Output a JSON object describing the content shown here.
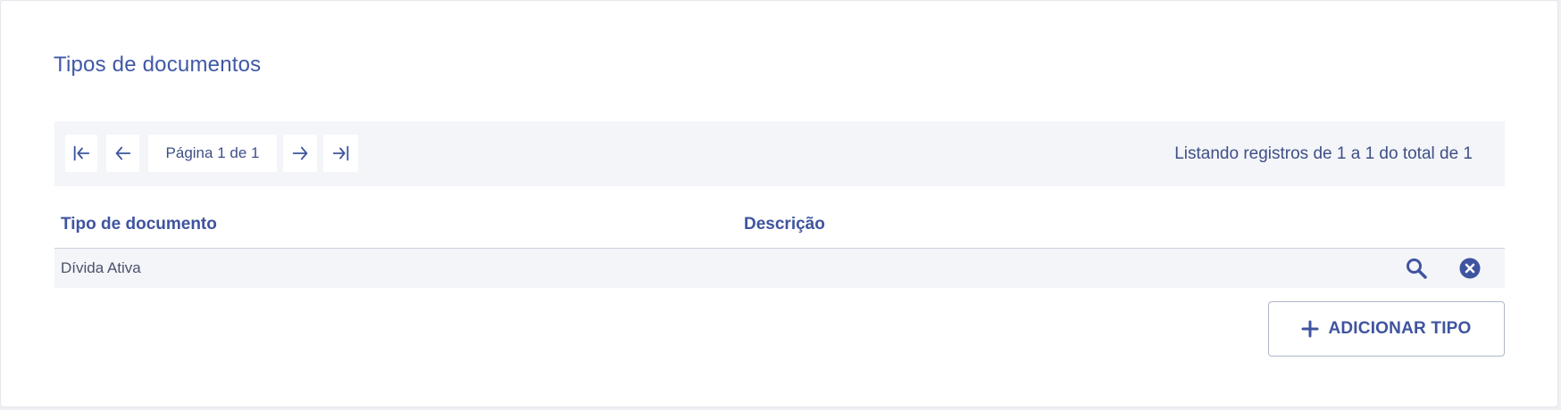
{
  "page": {
    "title": "Tipos de documentos"
  },
  "pagination": {
    "first_icon": "first-page-icon",
    "prev_icon": "arrow-left-icon",
    "label": "Página 1 de 1",
    "next_icon": "arrow-right-icon",
    "last_icon": "last-page-icon",
    "listing_text": "Listando registros de 1 a 1 do total de 1"
  },
  "table": {
    "columns": [
      "Tipo de documento",
      "Descrição"
    ],
    "rows": [
      {
        "tipo": "Dívida Ativa",
        "descricao": "",
        "actions": [
          "search-icon",
          "remove-icon"
        ]
      }
    ]
  },
  "actions": {
    "add_label": "ADICIONAR TIPO",
    "add_icon": "plus-icon"
  },
  "colors": {
    "accent": "#3f54a0",
    "toolbar_bg": "#f4f5f9",
    "row_bg": "#f4f5f9"
  }
}
